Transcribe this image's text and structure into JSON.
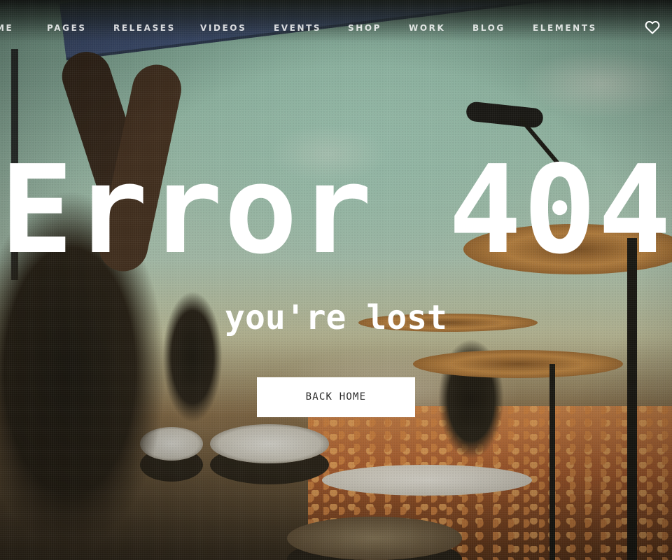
{
  "nav": {
    "items": [
      {
        "label": "ME"
      },
      {
        "label": "PAGES"
      },
      {
        "label": "RELEASES"
      },
      {
        "label": "VIDEOS"
      },
      {
        "label": "EVENTS"
      },
      {
        "label": "SHOP"
      },
      {
        "label": "WORK"
      },
      {
        "label": "BLOG"
      },
      {
        "label": "ELEMENTS"
      }
    ],
    "wishlist_icon": "heart-icon"
  },
  "hero": {
    "title": "Error 404",
    "subtitle": "you're lost",
    "button_label": "BACK HOME"
  },
  "background": {
    "subject": "concert-stage-photo",
    "icon": "background-image"
  },
  "colors": {
    "text": "#ffffff",
    "button_bg": "#ffffff",
    "button_text": "#2b2b2b"
  }
}
